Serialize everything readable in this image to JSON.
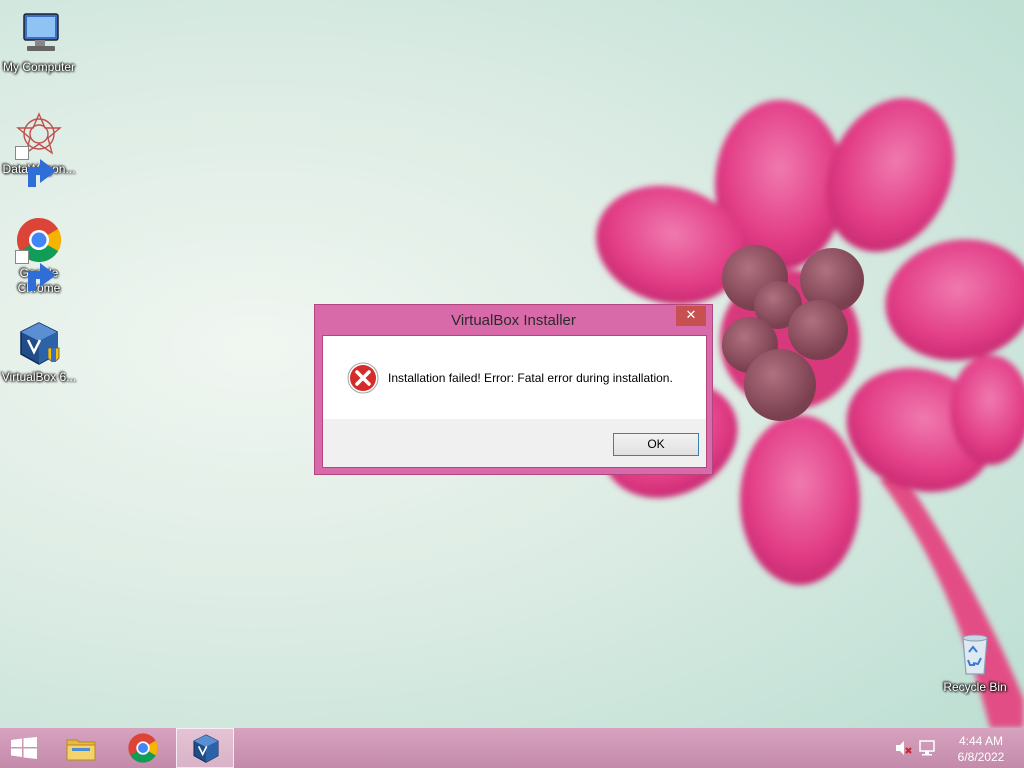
{
  "desktop": {
    "icons": [
      {
        "label": "My Computer",
        "icon": "computer-icon"
      },
      {
        "label": "DataWagon...",
        "icon": "datawagon-icon"
      },
      {
        "label": "Google Chrome",
        "icon": "chrome-icon"
      },
      {
        "label": "VirtualBox 6...",
        "icon": "virtualbox-icon"
      },
      {
        "label": "Recycle Bin",
        "icon": "recycle-bin-icon"
      }
    ]
  },
  "dialog": {
    "title": "VirtualBox Installer",
    "close_glyph": "✕",
    "message": "Installation failed! Error: Fatal error during installation.",
    "ok_label": "OK"
  },
  "taskbar": {
    "items": [
      {
        "icon": "windows-start-icon"
      },
      {
        "icon": "file-explorer-icon"
      },
      {
        "icon": "chrome-icon"
      },
      {
        "icon": "virtualbox-icon",
        "active": true
      }
    ],
    "tray": {
      "time": "4:44 AM",
      "date": "6/8/2022",
      "icons": [
        "volume-muted-icon",
        "network-icon"
      ]
    }
  },
  "colors": {
    "dialog_frame": "#d86aa9",
    "close_button": "#c75050",
    "taskbar": "#c993b0",
    "flower": "#e5408a"
  }
}
